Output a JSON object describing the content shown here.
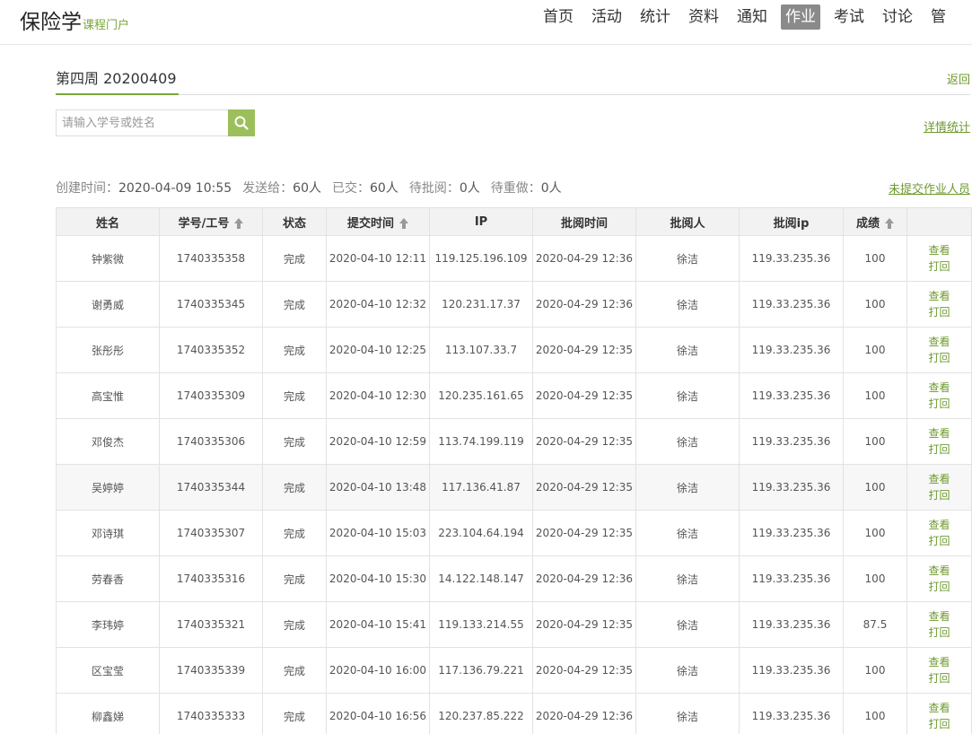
{
  "header": {
    "brand_main": "保险学",
    "brand_sub": "课程门户",
    "nav": [
      "首页",
      "活动",
      "统计",
      "资料",
      "通知",
      "作业",
      "考试",
      "讨论",
      "管"
    ],
    "active_index": 5
  },
  "page": {
    "title": "第四周 20200409",
    "back_label": "返回",
    "search_placeholder": "请输入学号或姓名",
    "stats_label": "详情统计",
    "missing_label": "未提交作业人员"
  },
  "meta": {
    "created_label": "创建时间：",
    "created_value": "2020-04-09 10:55",
    "sent_label": "发送给：",
    "sent_value": "60人",
    "submitted_label": "已交：",
    "submitted_value": "60人",
    "pending_label": "待批阅：",
    "pending_value": "0人",
    "redo_label": "待重做：",
    "redo_value": "0人"
  },
  "table": {
    "headers": {
      "name": "姓名",
      "id": "学号/工号",
      "status": "状态",
      "submit_time": "提交时间",
      "ip": "IP",
      "review_time": "批阅时间",
      "reviewer": "批阅人",
      "review_ip": "批阅ip",
      "score": "成绩",
      "actions": ""
    },
    "view_label": "查看",
    "return_label": "打回",
    "rows": [
      {
        "name": "钟紫微",
        "id": "1740335358",
        "status": "完成",
        "submit_time": "2020-04-10 12:11",
        "ip": "119.125.196.109",
        "review_time": "2020-04-29 12:36",
        "reviewer": "徐洁",
        "review_ip": "119.33.235.36",
        "score": "100"
      },
      {
        "name": "谢勇威",
        "id": "1740335345",
        "status": "完成",
        "submit_time": "2020-04-10 12:32",
        "ip": "120.231.17.37",
        "review_time": "2020-04-29 12:36",
        "reviewer": "徐洁",
        "review_ip": "119.33.235.36",
        "score": "100"
      },
      {
        "name": "张彤彤",
        "id": "1740335352",
        "status": "完成",
        "submit_time": "2020-04-10 12:25",
        "ip": "113.107.33.7",
        "review_time": "2020-04-29 12:35",
        "reviewer": "徐洁",
        "review_ip": "119.33.235.36",
        "score": "100"
      },
      {
        "name": "高宝惟",
        "id": "1740335309",
        "status": "完成",
        "submit_time": "2020-04-10 12:30",
        "ip": "120.235.161.65",
        "review_time": "2020-04-29 12:35",
        "reviewer": "徐洁",
        "review_ip": "119.33.235.36",
        "score": "100"
      },
      {
        "name": "邓俊杰",
        "id": "1740335306",
        "status": "完成",
        "submit_time": "2020-04-10 12:59",
        "ip": "113.74.199.119",
        "review_time": "2020-04-29 12:35",
        "reviewer": "徐洁",
        "review_ip": "119.33.235.36",
        "score": "100"
      },
      {
        "name": "吴婷婷",
        "id": "1740335344",
        "status": "完成",
        "submit_time": "2020-04-10 13:48",
        "ip": "117.136.41.87",
        "review_time": "2020-04-29 12:35",
        "reviewer": "徐洁",
        "review_ip": "119.33.235.36",
        "score": "100"
      },
      {
        "name": "邓诗琪",
        "id": "1740335307",
        "status": "完成",
        "submit_time": "2020-04-10 15:03",
        "ip": "223.104.64.194",
        "review_time": "2020-04-29 12:35",
        "reviewer": "徐洁",
        "review_ip": "119.33.235.36",
        "score": "100"
      },
      {
        "name": "劳春香",
        "id": "1740335316",
        "status": "完成",
        "submit_time": "2020-04-10 15:30",
        "ip": "14.122.148.147",
        "review_time": "2020-04-29 12:36",
        "reviewer": "徐洁",
        "review_ip": "119.33.235.36",
        "score": "100"
      },
      {
        "name": "李玮婷",
        "id": "1740335321",
        "status": "完成",
        "submit_time": "2020-04-10 15:41",
        "ip": "119.133.214.55",
        "review_time": "2020-04-29 12:35",
        "reviewer": "徐洁",
        "review_ip": "119.33.235.36",
        "score": "87.5"
      },
      {
        "name": "区宝莹",
        "id": "1740335339",
        "status": "完成",
        "submit_time": "2020-04-10 16:00",
        "ip": "117.136.79.221",
        "review_time": "2020-04-29 12:35",
        "reviewer": "徐洁",
        "review_ip": "119.33.235.36",
        "score": "100"
      },
      {
        "name": "柳鑫娣",
        "id": "1740335333",
        "status": "完成",
        "submit_time": "2020-04-10 16:56",
        "ip": "120.237.85.222",
        "review_time": "2020-04-29 12:36",
        "reviewer": "徐洁",
        "review_ip": "119.33.235.36",
        "score": "100"
      }
    ]
  },
  "colors": {
    "accent": "#7aa63a",
    "link": "#6e9a2e",
    "active_nav_bg": "#8a8a8a",
    "search_button": "#9cbf5c"
  }
}
